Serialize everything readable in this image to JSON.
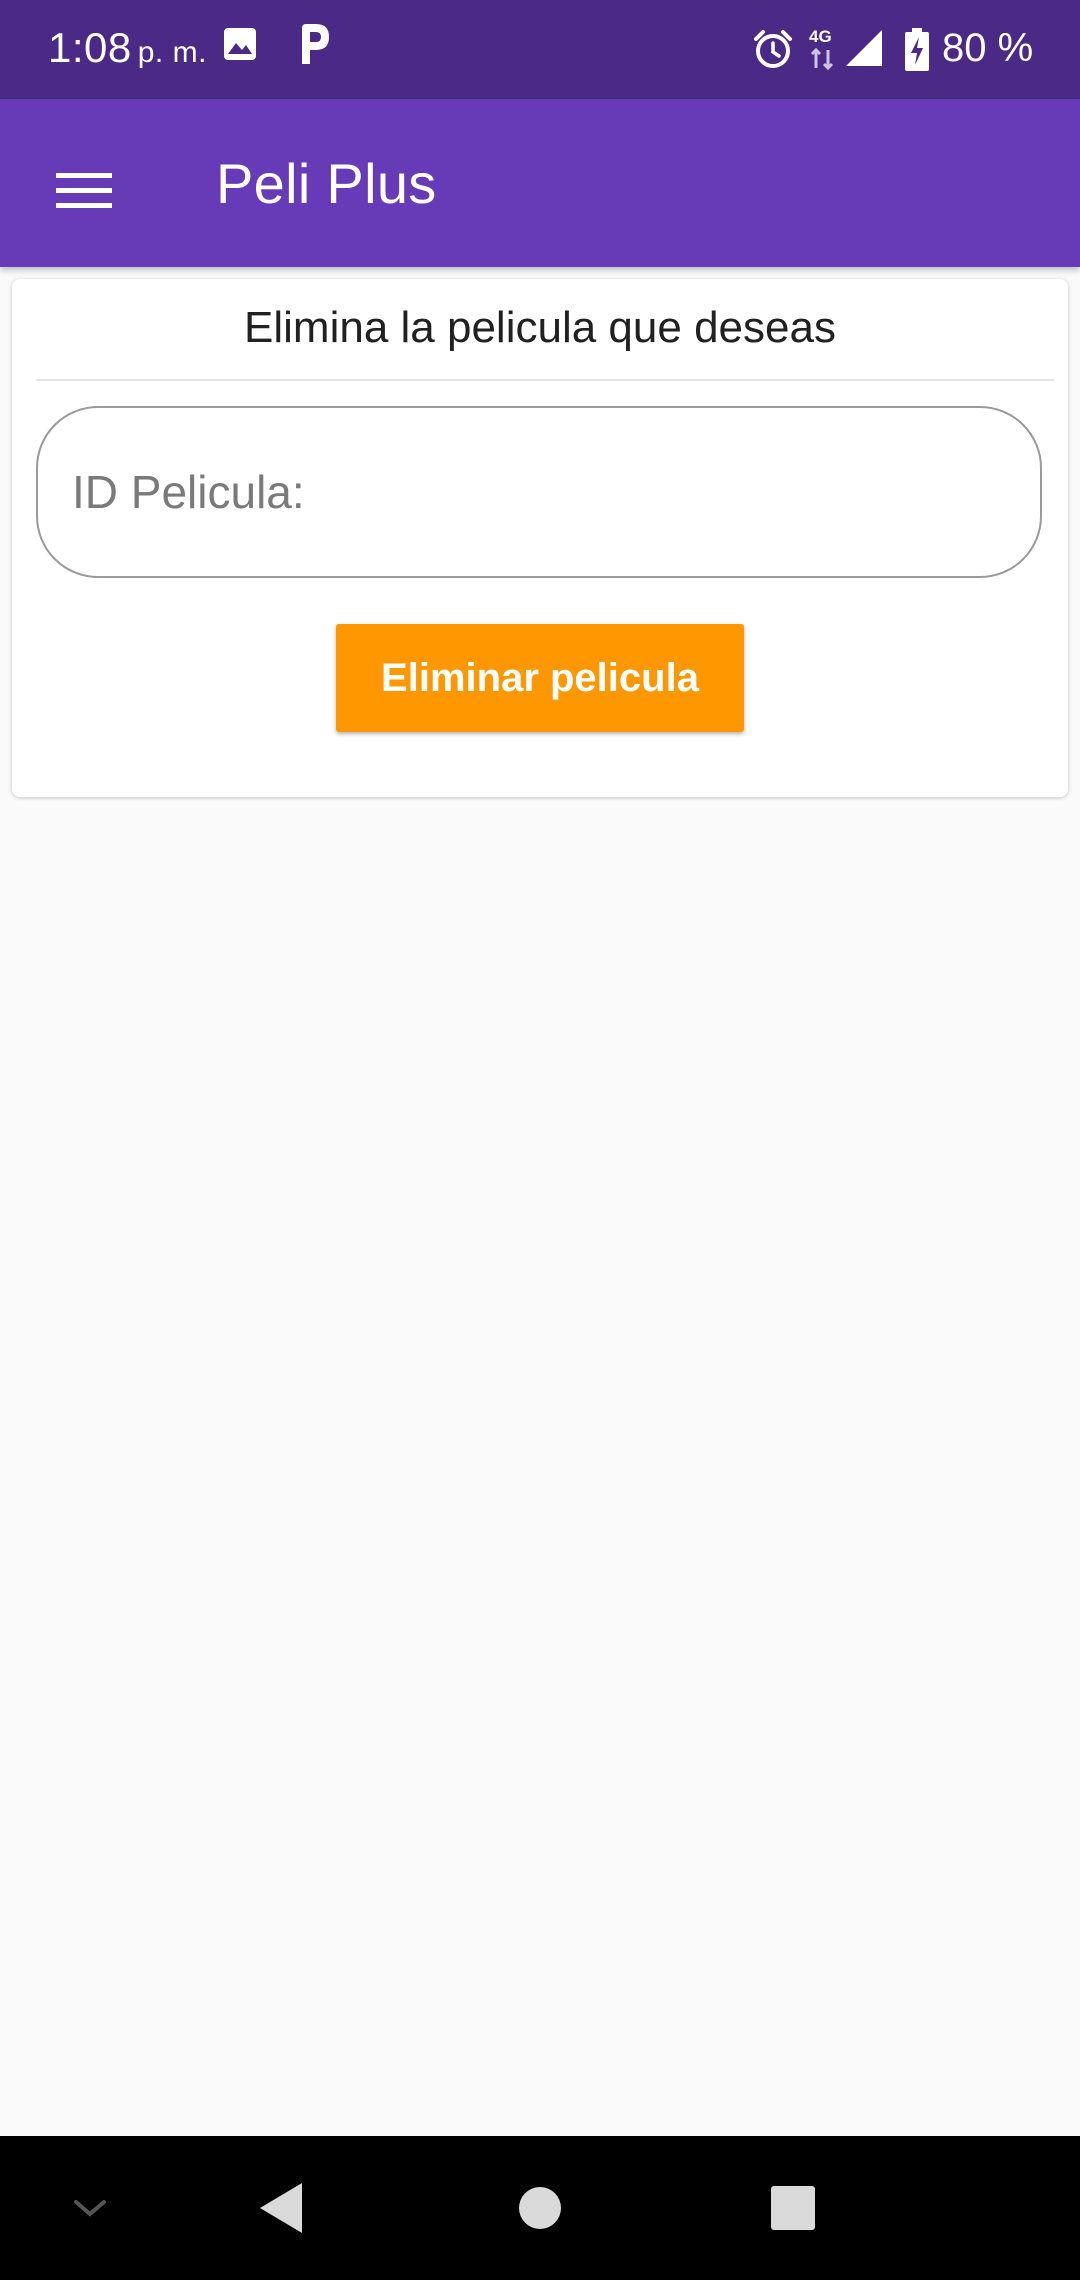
{
  "status_bar": {
    "time": "1:08",
    "ampm": "p. m.",
    "network_label": "4G",
    "battery": "80 %",
    "icons": [
      "image-icon",
      "parking-icon",
      "alarm-icon",
      "network-4g-icon",
      "signal-icon",
      "battery-charging-icon"
    ]
  },
  "app_bar": {
    "title": "Peli Plus",
    "menu_icon": "hamburger-menu-icon"
  },
  "card": {
    "title": "Elimina la pelicula que deseas",
    "input_placeholder": "ID Pelicula:",
    "input_value": "",
    "button_label": "Eliminar pelicula"
  },
  "nav_bar": {
    "icons": [
      "chevron-down-icon",
      "back-icon",
      "home-icon",
      "recents-icon"
    ]
  },
  "colors": {
    "status_bar": "#4a2a86",
    "app_bar": "#673ab7",
    "button": "#ff9800",
    "background": "#fafafa"
  }
}
